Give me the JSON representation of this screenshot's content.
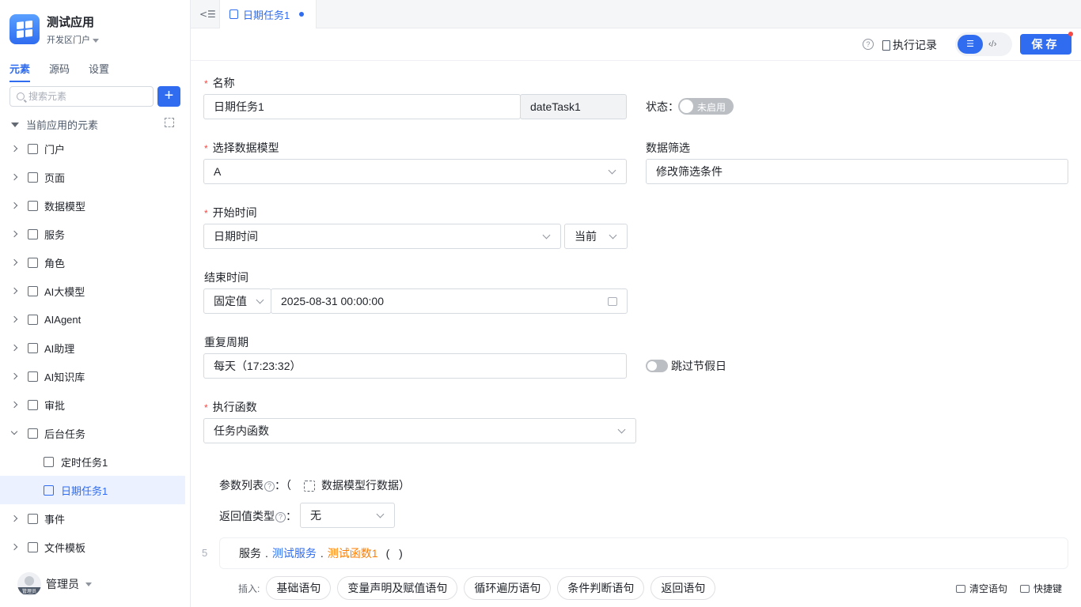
{
  "app": {
    "name": "测试应用",
    "portal": "开发区门户"
  },
  "sidebar": {
    "tabs": [
      "元素",
      "源码",
      "设置"
    ],
    "search_placeholder": "搜索元素",
    "add_label": "+",
    "root": "当前应用的元素",
    "items": [
      {
        "label": "门户"
      },
      {
        "label": "页面"
      },
      {
        "label": "数据模型"
      },
      {
        "label": "服务"
      },
      {
        "label": "角色"
      },
      {
        "label": "AI大模型"
      },
      {
        "label": "AIAgent"
      },
      {
        "label": "AI助理"
      },
      {
        "label": "AI知识库"
      },
      {
        "label": "审批"
      },
      {
        "label": "后台任务"
      },
      {
        "label": "定时任务1"
      },
      {
        "label": "日期任务1"
      },
      {
        "label": "事件"
      },
      {
        "label": "文件模板"
      }
    ],
    "user": {
      "name": "管理员",
      "avatar_text": "管理员"
    }
  },
  "tabbar": {
    "collapse": "<☰",
    "active_tab": "日期任务1"
  },
  "toolbar": {
    "help": "?",
    "exec_log": "执行记录",
    "save": "保存"
  },
  "form": {
    "name_label": "名称",
    "name_value": "日期任务1",
    "code_value": "dateTask1",
    "status_label": "状态：",
    "status_toggle": "未启用",
    "model_label": "选择数据模型",
    "model_value": "A",
    "filter_label": "数据筛选",
    "filter_value": "修改筛选条件",
    "start_label": "开始时间",
    "start_value": "日期时间",
    "start_mode": "当前",
    "end_label": "结束时间",
    "end_mode": "固定值",
    "end_value": "2025-08-31 00:00:00",
    "repeat_label": "重复周期",
    "repeat_value": "每天（17:23:32）",
    "skip_holiday": "跳过节假日",
    "func_label": "执行函数",
    "func_value": "任务内函数",
    "param_label": "参数列表",
    "param_colon": "：",
    "param_open": "（",
    "param_value": "数据模型行数据",
    "param_close": "）",
    "return_label": "返回值类型",
    "return_value": "无"
  },
  "code": {
    "line_no": "5",
    "service": "服务",
    "sep": ".",
    "service_name": "测试服务",
    "func_name": "测试函数1",
    "parens": "( )"
  },
  "insert": {
    "label": "插入:",
    "chips": [
      "基础语句",
      "变量声明及赋值语句",
      "循环遍历语句",
      "条件判断语句",
      "返回语句"
    ],
    "clear": "清空语句",
    "shortcut": "快捷键"
  },
  "colors": {
    "primary": "#2f6cf0",
    "required": "#f54a45",
    "func": "#ff7d00"
  }
}
